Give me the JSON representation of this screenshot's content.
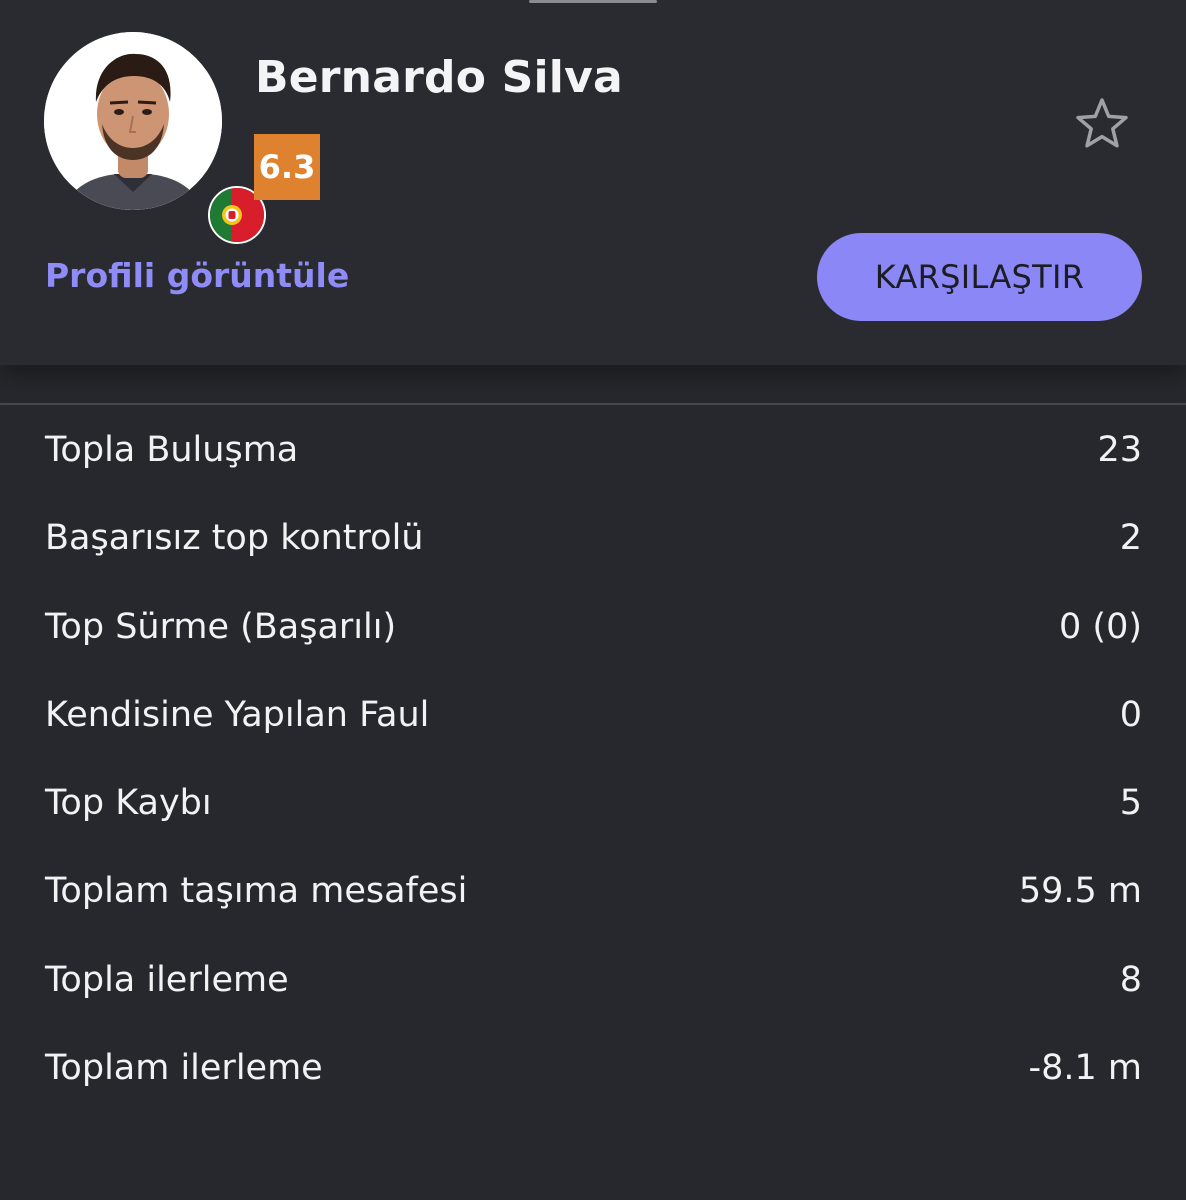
{
  "player": {
    "name": "Bernardo Silva",
    "rating": "6.3",
    "nationality_flag": "portugal-flag-icon"
  },
  "actions": {
    "profile_link": "Profili görüntüle",
    "compare_button": "KARŞILAŞTIR",
    "favorite_icon": "star-outline-icon"
  },
  "stats": [
    {
      "label": "Topla Buluşma",
      "value": "23"
    },
    {
      "label": "Başarısız top kontrolü",
      "value": "2"
    },
    {
      "label": "Top Sürme (Başarılı)",
      "value": "0 (0)"
    },
    {
      "label": "Kendisine Yapılan Faul",
      "value": "0"
    },
    {
      "label": "Top Kaybı",
      "value": "5"
    },
    {
      "label": "Toplam taşıma mesafesi",
      "value": "59.5 m"
    },
    {
      "label": "Topla ilerleme",
      "value": "8"
    },
    {
      "label": "Toplam ilerleme",
      "value": "-8.1 m"
    }
  ],
  "colors": {
    "background": "#26282d",
    "accent": "#8b87f7",
    "rating_badge": "#df8230"
  }
}
